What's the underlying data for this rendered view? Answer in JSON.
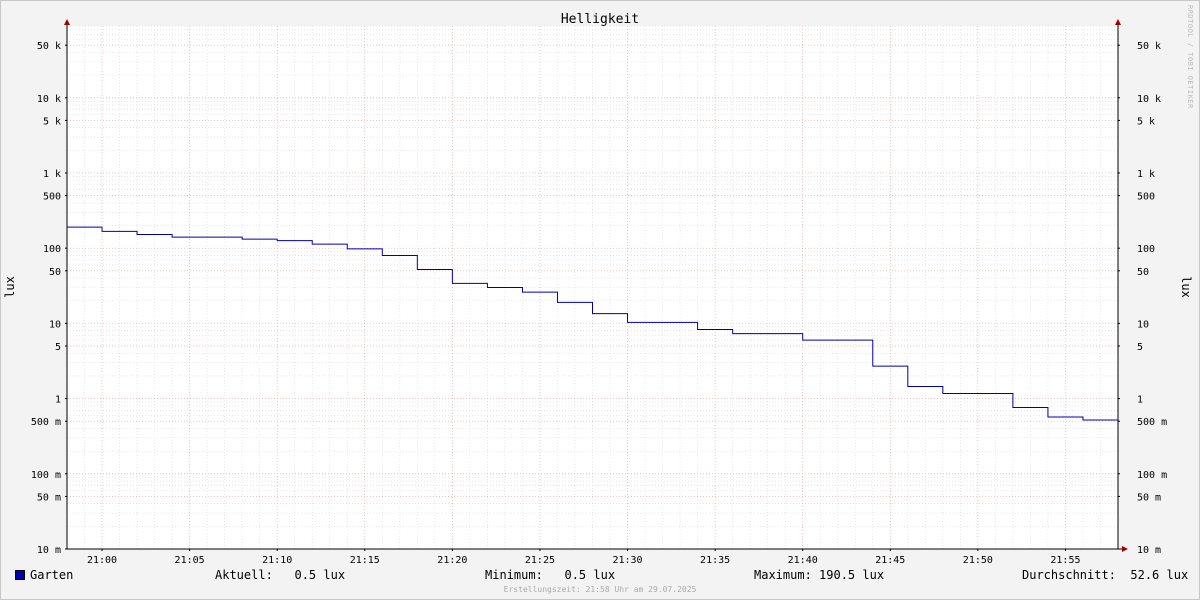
{
  "chart_data": {
    "type": "line",
    "title": "Helligkeit",
    "ylabel": "lux",
    "y_scale": "log",
    "ylim": [
      0.01,
      90000
    ],
    "x_range": [
      "20:58",
      "21:58"
    ],
    "x_ticks": [
      "21:00",
      "21:05",
      "21:10",
      "21:15",
      "21:20",
      "21:25",
      "21:30",
      "21:35",
      "21:40",
      "21:45",
      "21:50",
      "21:55"
    ],
    "y_ticks": [
      {
        "value": 50000,
        "label": "50 k"
      },
      {
        "value": 10000,
        "label": "10 k"
      },
      {
        "value": 5000,
        "label": "5 k"
      },
      {
        "value": 1000,
        "label": "1 k"
      },
      {
        "value": 500,
        "label": "500"
      },
      {
        "value": 100,
        "label": "100"
      },
      {
        "value": 50,
        "label": "50"
      },
      {
        "value": 10,
        "label": "10"
      },
      {
        "value": 5,
        "label": "5"
      },
      {
        "value": 1,
        "label": "1"
      },
      {
        "value": 0.5,
        "label": "500 m"
      },
      {
        "value": 0.1,
        "label": "100 m"
      },
      {
        "value": 0.05,
        "label": "50 m"
      },
      {
        "value": 0.01,
        "label": "10 m"
      }
    ],
    "grid": true,
    "step": true,
    "series": [
      {
        "name": "Garten",
        "color": "#0000aa",
        "points": [
          {
            "t": "20:58",
            "v": 190.5
          },
          {
            "t": "21:00",
            "v": 167
          },
          {
            "t": "21:02",
            "v": 152
          },
          {
            "t": "21:04",
            "v": 140
          },
          {
            "t": "21:08",
            "v": 132
          },
          {
            "t": "21:10",
            "v": 126
          },
          {
            "t": "21:12",
            "v": 113
          },
          {
            "t": "21:14",
            "v": 98
          },
          {
            "t": "21:16",
            "v": 80
          },
          {
            "t": "21:18",
            "v": 52
          },
          {
            "t": "21:20",
            "v": 34
          },
          {
            "t": "21:22",
            "v": 30
          },
          {
            "t": "21:24",
            "v": 26
          },
          {
            "t": "21:26",
            "v": 19
          },
          {
            "t": "21:28",
            "v": 13.5
          },
          {
            "t": "21:30",
            "v": 10.3
          },
          {
            "t": "21:34",
            "v": 8.3
          },
          {
            "t": "21:36",
            "v": 7.3
          },
          {
            "t": "21:40",
            "v": 6.0
          },
          {
            "t": "21:44",
            "v": 2.7
          },
          {
            "t": "21:46",
            "v": 1.45
          },
          {
            "t": "21:48",
            "v": 1.17
          },
          {
            "t": "21:52",
            "v": 0.76
          },
          {
            "t": "21:54",
            "v": 0.57
          },
          {
            "t": "21:56",
            "v": 0.52
          },
          {
            "t": "21:58",
            "v": 0.52
          }
        ]
      }
    ]
  },
  "legend": {
    "series_name": "Garten",
    "current": "Aktuell:   0.5 lux",
    "minimum": "Minimum:   0.5 lux",
    "maximum": "Maximum: 190.5 lux",
    "average": "Durchschnitt:  52.6 lux"
  },
  "watermark": "RRDTOOL / TOBI OETIKER",
  "footer": "Erstellungszeit: 21:58 Uhr am 29.07.2025"
}
